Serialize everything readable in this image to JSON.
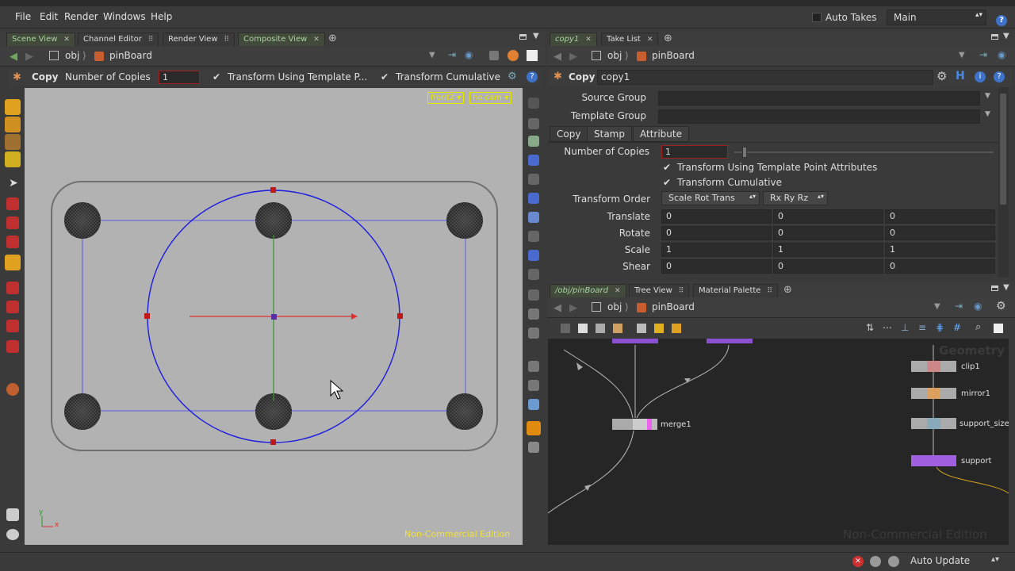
{
  "menu": {
    "items": [
      "File",
      "Edit",
      "Render",
      "Windows",
      "Help"
    ]
  },
  "header": {
    "auto_takes": "Auto Takes",
    "desktop": "Main"
  },
  "left_tabs": [
    "Scene View",
    "Channel Editor",
    "Render View",
    "Composite View"
  ],
  "left_path": {
    "root": "obj",
    "node": "pinBoard"
  },
  "tool_options": {
    "tool": "Copy",
    "copies_label": "Number of Copies",
    "copies_value": "1",
    "opt1": "Transform Using Template P...",
    "opt2": "Transform Cumulative"
  },
  "viewport": {
    "camera_view": "front2",
    "camera": "no cam",
    "watermark": "Non-Commercial Edition",
    "axis_y": "y",
    "axis_x": "x"
  },
  "right_tabs": [
    "copy1",
    "Take List"
  ],
  "right_path": {
    "root": "obj",
    "node": "pinBoard"
  },
  "params": {
    "type": "Copy",
    "name": "copy1",
    "source_group": "Source Group",
    "template_group": "Template Group",
    "tabs": [
      "Copy",
      "Stamp",
      "Attribute"
    ],
    "num_copies_label": "Number of Copies",
    "num_copies": "1",
    "chk1": "Transform Using Template Point Attributes",
    "chk2": "Transform Cumulative",
    "order_label": "Transform Order",
    "order": "Scale Rot Trans",
    "rot_order": "Rx Ry Rz",
    "translate_label": "Translate",
    "translate": [
      "0",
      "0",
      "0"
    ],
    "rotate_label": "Rotate",
    "rotate": [
      "0",
      "0",
      "0"
    ],
    "scale_label": "Scale",
    "scale": [
      "1",
      "1",
      "1"
    ],
    "shear_label": "Shear",
    "shear": [
      "0",
      "0",
      "0"
    ]
  },
  "net_tabs": [
    "/obj/pinBoard",
    "Tree View",
    "Material Palette"
  ],
  "net_path": {
    "root": "obj",
    "node": "pinBoard"
  },
  "network": {
    "context": "Geometry",
    "watermark": "Non-Commercial Edition",
    "nodes": [
      "merge1",
      "clip1",
      "mirror1",
      "support_size_",
      "support"
    ]
  },
  "status": {
    "update": "Auto Update"
  }
}
